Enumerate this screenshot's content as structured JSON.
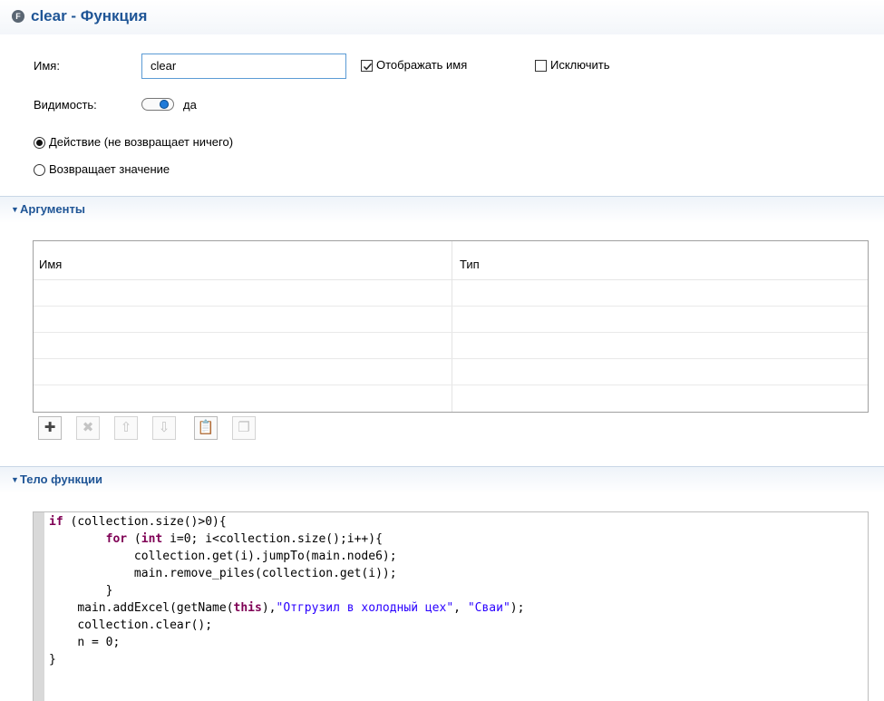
{
  "title": {
    "icon": "function-icon",
    "icon_letter": "F",
    "text": "clear - Функция"
  },
  "form": {
    "name_label": "Имя:",
    "name_value": "clear",
    "show_name_label": "Отображать имя",
    "show_name_checked": true,
    "exclude_label": "Исключить",
    "exclude_checked": false,
    "visibility_label": "Видимость:",
    "visibility_value": "да",
    "visibility_on": true,
    "radio_action_label": "Действие (не возвращает ничего)",
    "radio_action_selected": true,
    "radio_return_label": "Возвращает значение",
    "radio_return_selected": false
  },
  "arguments_section": {
    "title": "Аргументы",
    "columns": [
      "Имя",
      "Тип"
    ],
    "rows": [],
    "toolbar": [
      {
        "icon": "add-icon",
        "glyph": "✚",
        "enabled": true
      },
      {
        "icon": "delete-icon",
        "glyph": "✖",
        "enabled": false
      },
      {
        "icon": "move-up-icon",
        "glyph": "⇧",
        "enabled": false
      },
      {
        "icon": "move-down-icon",
        "glyph": "⇩",
        "enabled": false
      },
      {
        "icon": "paste-icon",
        "glyph": "📋",
        "enabled": true
      },
      {
        "icon": "copy-icon",
        "glyph": "❐",
        "enabled": false
      }
    ]
  },
  "body_section": {
    "title": "Тело функции",
    "code_lines": [
      "if (collection.size()>0){",
      "        for (int i=0; i<collection.size();i++){",
      "            collection.get(i).jumpTo(main.node6);",
      "            main.remove_piles(collection.get(i));",
      "        }",
      "    main.addExcel(getName(this),\"Отгрузил в холодный цех\", \"Сваи\");",
      "    collection.clear();",
      "    n = 0;",
      "}"
    ]
  },
  "colors": {
    "title_blue": "#1f5596",
    "keyword": "#7f0055",
    "string": "#2a00ff",
    "toggle_knob": "#1e7ad9"
  }
}
